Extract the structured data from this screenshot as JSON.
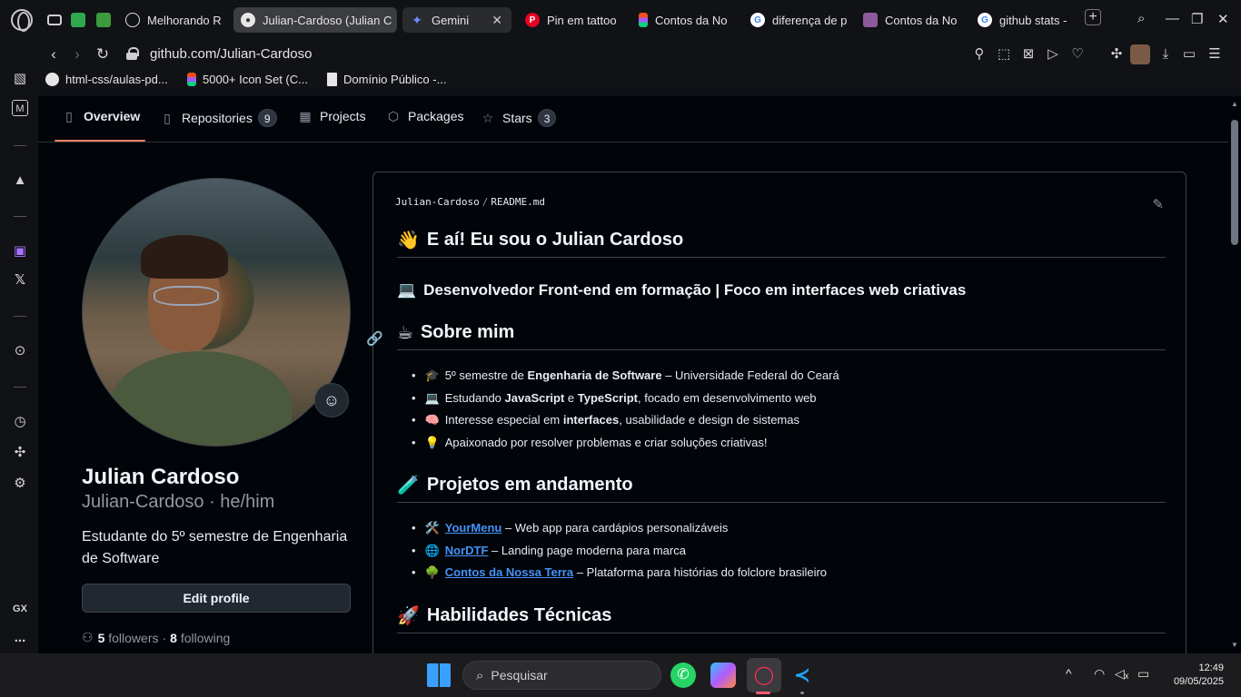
{
  "browser": {
    "tabs": [
      {
        "label": "Melhorando R",
        "favicon": "chatgpt-icon",
        "active": false
      },
      {
        "label": "Julian-Cardoso (Julian C",
        "favicon": "github-icon",
        "active": true
      },
      {
        "label": "Gemini",
        "favicon": "gemini-icon",
        "active": false,
        "has_close": true
      },
      {
        "label": "Pin em tattoo",
        "favicon": "pinterest-icon",
        "active": false
      },
      {
        "label": "Contos da No",
        "favicon": "figma-icon",
        "active": false
      },
      {
        "label": "diferença de p",
        "favicon": "google-icon",
        "active": false
      },
      {
        "label": "Contos da No",
        "favicon": "folder-icon",
        "active": false
      },
      {
        "label": "github stats -",
        "favicon": "google-icon",
        "active": false
      }
    ],
    "close_glyph": "✕",
    "new_tab": "+",
    "url": "github.com/Julian-Cardoso",
    "bookmarks": [
      {
        "label": "html-css/aulas-pd...",
        "icon": "github-icon"
      },
      {
        "label": "5000+ Icon Set (C...",
        "icon": "figma-icon"
      },
      {
        "label": "Domínio Público -...",
        "icon": "document-icon"
      }
    ]
  },
  "github": {
    "nav": {
      "overview": "Overview",
      "repositories": "Repositories",
      "repositories_count": "9",
      "projects": "Projects",
      "packages": "Packages",
      "stars": "Stars",
      "stars_count": "3"
    },
    "profile": {
      "name": "Julian Cardoso",
      "login": "Julian-Cardoso · he/him",
      "bio": "Estudante do 5º semestre de Engenharia de Software",
      "edit_button": "Edit profile",
      "followers_count": "5",
      "followers_label": "followers",
      "dot": "·",
      "following_count": "8",
      "following_label": "following"
    },
    "readme": {
      "path_user": "Julian-Cardoso",
      "path_sep": "/",
      "path_file": "README.md",
      "h1": {
        "emoji": "👋",
        "text": "E aí! Eu sou o Julian Cardoso"
      },
      "h3": {
        "emoji": "💻",
        "text": "Desenvolvedor Front-end em formação | Foco em interfaces web criativas"
      },
      "about": {
        "emoji": "☕",
        "title": "Sobre mim",
        "items": [
          {
            "emoji": "🎓",
            "pre": "5º semestre de ",
            "bold": "Engenharia de Software",
            "post": " – Universidade Federal do Ceará"
          },
          {
            "emoji": "💻",
            "pre": "Estudando ",
            "bold": "JavaScript",
            "mid": " e ",
            "bold2": "TypeScript",
            "post": ", focado em desenvolvimento web"
          },
          {
            "emoji": "🧠",
            "pre": "Interesse especial em ",
            "bold": "interfaces",
            "post": ", usabilidade e design de sistemas"
          },
          {
            "emoji": "💡",
            "pre": "Apaixonado por resolver problemas e criar soluções criativas!"
          }
        ]
      },
      "projects": {
        "emoji": "🧪",
        "title": "Projetos em andamento",
        "items": [
          {
            "emoji": "🛠️",
            "link": "YourMenu",
            "post": " – Web app para cardápios personalizáveis"
          },
          {
            "emoji": "🌐",
            "link": "NorDTF",
            "post": " – Landing page moderna para marca"
          },
          {
            "emoji": "🌳",
            "link": "Contos da Nossa Terra",
            "post": " – Plataforma para histórias do folclore brasileiro"
          }
        ]
      },
      "skills": {
        "emoji": "🚀",
        "title": "Habilidades Técnicas"
      }
    }
  },
  "taskbar": {
    "search_placeholder": "Pesquisar",
    "time": "12:49",
    "date": "09/05/2025"
  },
  "sidebar": {
    "gx_label": "GX",
    "more_label": "..."
  },
  "colors": {
    "accent_underline": "#f78166",
    "link": "#4493f8",
    "bg": "#010409"
  }
}
